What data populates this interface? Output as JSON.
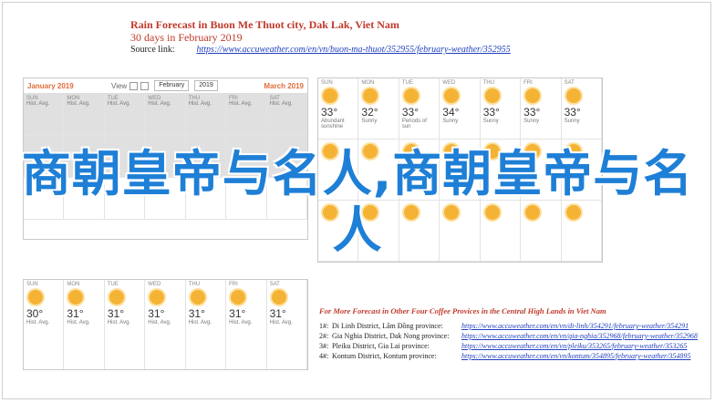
{
  "header": {
    "title": "Rain Forecast in Buon Me Thuot city, Dak Lak, Viet Nam",
    "subtitle": "30 days in February 2019",
    "source_label": "Source link:",
    "source_url": "https://www.accuweather.com/en/vn/buon-ma-thuot/352955/february-weather/352955"
  },
  "calendar_toolbar": {
    "prev_month": "January 2019",
    "view_label": "View",
    "month_select": "February",
    "year_select": "2019",
    "next_month": "March 2019"
  },
  "panel1_cells": [
    {
      "dow": "SUN",
      "big": "",
      "sm": "Hist. Avg."
    },
    {
      "dow": "MON",
      "big": "",
      "sm": "Hist. Avg."
    },
    {
      "dow": "TUE",
      "big": "",
      "sm": "Hist. Avg."
    },
    {
      "dow": "WED",
      "big": "",
      "sm": "Hist. Avg."
    },
    {
      "dow": "THU",
      "big": "",
      "sm": "Hist. Avg."
    },
    {
      "dow": "FRI",
      "big": "",
      "sm": "Hist. Avg."
    },
    {
      "dow": "SAT",
      "big": "",
      "sm": "Hist. Avg."
    }
  ],
  "panel2_cells": [
    {
      "dow": "SUN",
      "big": "33°",
      "sm": "Abundant sunshine"
    },
    {
      "dow": "MON",
      "big": "32°",
      "sm": "Sunny"
    },
    {
      "dow": "TUE",
      "big": "33°",
      "sm": "Periods of sun"
    },
    {
      "dow": "WED",
      "big": "34°",
      "sm": "Sunny"
    },
    {
      "dow": "THU",
      "big": "33°",
      "sm": "Sunny"
    },
    {
      "dow": "FRI",
      "big": "33°",
      "sm": "Sunny"
    },
    {
      "dow": "SAT",
      "big": "33°",
      "sm": "Sunny"
    }
  ],
  "panel3_cells": [
    {
      "dow": "SUN",
      "big": "30°",
      "sm": "Hist. Avg."
    },
    {
      "dow": "MON",
      "big": "31°",
      "sm": "Hist. Avg."
    },
    {
      "dow": "TUE",
      "big": "31°",
      "sm": "Hist. Avg."
    },
    {
      "dow": "WED",
      "big": "31°",
      "sm": "Hist. Avg."
    },
    {
      "dow": "THU",
      "big": "31°",
      "sm": "Hist. Avg."
    },
    {
      "dow": "FRI",
      "big": "31°",
      "sm": "Hist. Avg."
    },
    {
      "dow": "SAT",
      "big": "31°",
      "sm": "Hist. Avg."
    }
  ],
  "more": {
    "title": "For More Forecast in Other Four Coffee Provices in the Central High Lands in Viet Nam",
    "items": [
      {
        "num": "1#:",
        "district": "Di Linh District, Lâm Đồng province:",
        "url": "https://www.accuweather.com/en/vn/di-linh/354291/february-weather/354291"
      },
      {
        "num": "2#:",
        "district": "Gia Nghia District, Dak Nong province:",
        "url": "https://www.accuweather.com/en/vn/gia-nghia/352968/february-weather/352968"
      },
      {
        "num": "3#:",
        "district": "Pleiku District, Gia Lai province:",
        "url": "https://www.accuweather.com/en/vn/pleiku/353265/february-weather/353265"
      },
      {
        "num": "4#:",
        "district": "Kontum District, Kontum province:",
        "url": "https://www.accuweather.com/en/vn/kontum/354895/february-weather/354895"
      }
    ]
  },
  "overlay_text": "商朝皇帝与名人,商朝皇帝与名人",
  "colors": {
    "accent": "#c0392b",
    "link": "#1f3fbf",
    "overlay": "#1e7fd6",
    "sun": "#f5b335"
  }
}
